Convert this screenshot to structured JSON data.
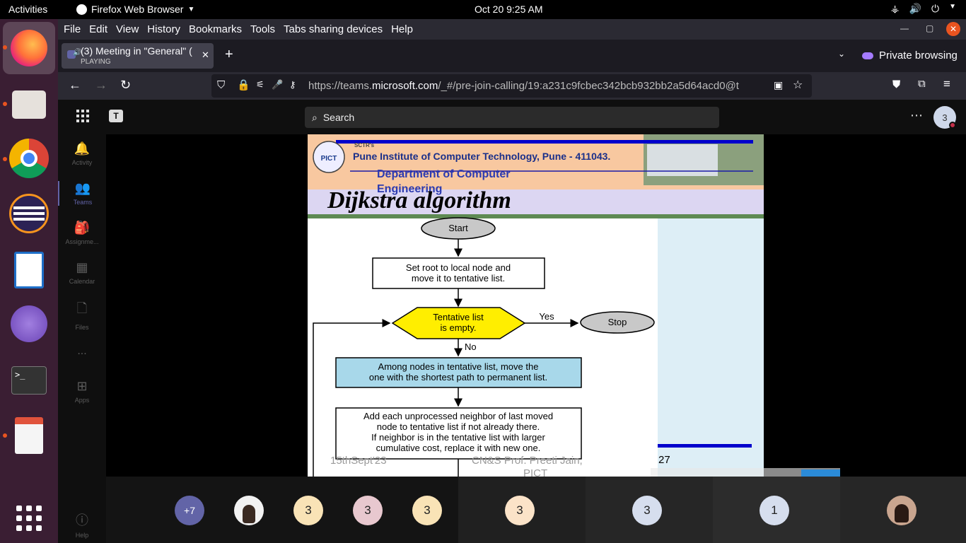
{
  "system": {
    "activities": "Activities",
    "app_name": "Firefox Web Browser",
    "clock": "Oct 20  9:25 AM"
  },
  "firefox": {
    "menu": [
      "File",
      "Edit",
      "View",
      "History",
      "Bookmarks",
      "Tools",
      "Tabs sharing devices",
      "Help"
    ],
    "tab_title": "(3) Meeting in \"General\" (",
    "tab_status": "PLAYING",
    "new_tab": "+",
    "private_label": "Private browsing",
    "url_prefix": "https://teams.",
    "url_domain": "microsoft.com",
    "url_rest": "/_#/pre-join-calling/19:a231c9fcbec342bcb932bb2a5d64acd0@t"
  },
  "teams": {
    "search_placeholder": "Search",
    "avatar_initial": "3",
    "rail": [
      {
        "label": "Activity",
        "icon": "bell-icon"
      },
      {
        "label": "Teams",
        "icon": "teams-icon"
      },
      {
        "label": "Assignme...",
        "icon": "assignments-icon"
      },
      {
        "label": "Calendar",
        "icon": "calendar-icon"
      },
      {
        "label": "Files",
        "icon": "file-icon"
      },
      {
        "label": "...",
        "icon": "more-icon"
      },
      {
        "label": "Apps",
        "icon": "apps-icon"
      },
      {
        "label": "Help",
        "icon": "help-icon"
      }
    ],
    "participants": [
      "+7",
      "",
      "3",
      "3",
      "3",
      "3",
      "3",
      "1",
      ""
    ]
  },
  "slide": {
    "org_short": "SCTR's",
    "institute": "Pune Institute of Computer Technology, Pune - 411043.",
    "logo_text": "PICT",
    "department_line1": "Department of Computer",
    "department_line2": "Engineering",
    "title": "Dijkstra algorithm",
    "flow": {
      "start": "Start",
      "step1_line1": "Set root to local node and",
      "step1_line2": "move it to tentative list.",
      "decision_line1": "Tentative list",
      "decision_line2": "is empty.",
      "yes": "Yes",
      "no": "No",
      "stop": "Stop",
      "step2_line1": "Among nodes in tentative list, move the",
      "step2_line2": "one with the shortest path to permanent list.",
      "step3_line1": "Add each unprocessed neighbor of last moved",
      "step3_line2": "node to tentative list if not already there.",
      "step3_line3": "If neighbor is in the tentative list with larger",
      "step3_line4": "cumulative cost, replace it with new one."
    },
    "footer_date": "15thSept'23",
    "footer_author_line1": "CN&S Prof. Preeti Jain,",
    "footer_author_line2": "PICT",
    "page_number": "27"
  },
  "colors": {
    "ubuntu_dock": "#3a1e33",
    "teams_purple": "#6264a7",
    "slide_blue_bar": "#0000cc"
  }
}
